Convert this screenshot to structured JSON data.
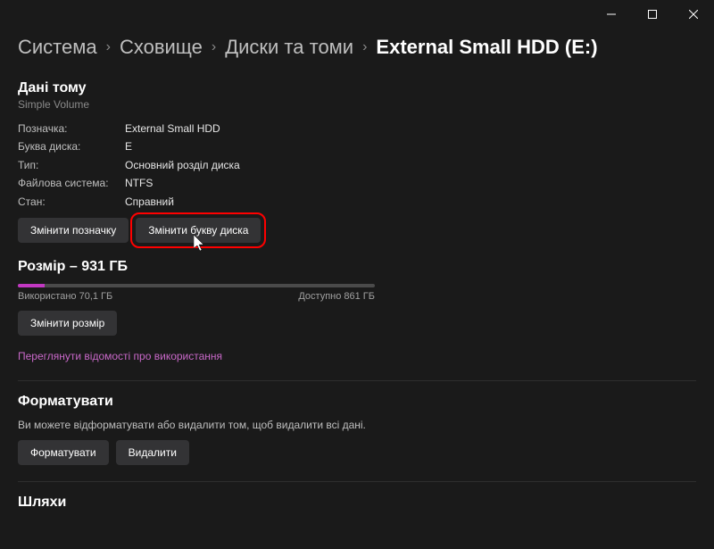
{
  "titlebar": {
    "minimize": "minimize",
    "maximize": "maximize",
    "close": "close"
  },
  "breadcrumb": {
    "items": [
      "Система",
      "Сховище",
      "Диски та томи",
      "External Small HDD (E:)"
    ]
  },
  "volume_data": {
    "heading": "Дані тому",
    "type_text": "Simple Volume",
    "rows": [
      {
        "key": "Позначка:",
        "val": "External Small HDD"
      },
      {
        "key": "Буква диска:",
        "val": "E"
      },
      {
        "key": "Тип:",
        "val": "Основний розділ диска"
      },
      {
        "key": "Файлова система:",
        "val": "NTFS"
      },
      {
        "key": "Стан:",
        "val": "Справний"
      }
    ],
    "buttons": {
      "change_label": "Змінити позначку",
      "change_letter": "Змінити букву диска"
    }
  },
  "size_section": {
    "heading": "Розмір – 931 ГБ",
    "used": "Використано 70,1 ГБ",
    "available": "Доступно 861 ГБ",
    "change_size": "Змінити розмір",
    "usage_link": "Переглянути відомості про використання"
  },
  "format_section": {
    "heading": "Форматувати",
    "description": "Ви можете відформатувати або видалити том, щоб видалити всі дані.",
    "format_btn": "Форматувати",
    "delete_btn": "Видалити"
  },
  "paths_section": {
    "heading": "Шляхи"
  }
}
